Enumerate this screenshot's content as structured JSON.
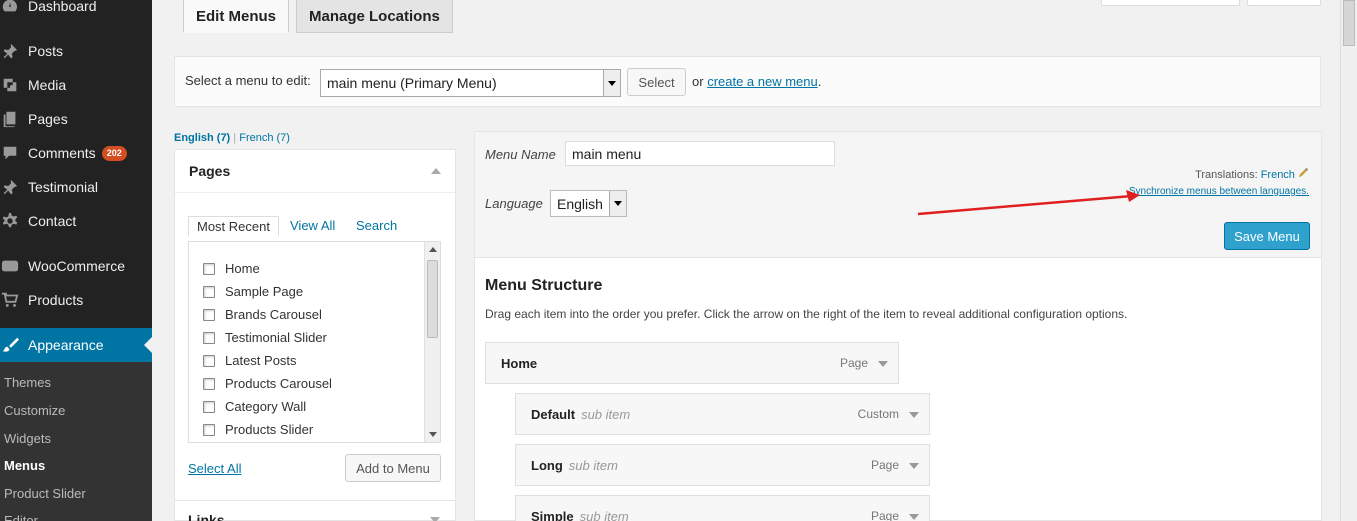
{
  "sidebar": {
    "items": [
      {
        "label": "Dashboard",
        "icon": "dashboard-icon"
      },
      {
        "label": "Posts",
        "icon": "pushpin-icon"
      },
      {
        "label": "Media",
        "icon": "media-icon"
      },
      {
        "label": "Pages",
        "icon": "pages-icon"
      },
      {
        "label": "Comments",
        "icon": "comment-icon",
        "badge": "202"
      },
      {
        "label": "Testimonial",
        "icon": "pushpin-icon"
      },
      {
        "label": "Contact",
        "icon": "gear-icon"
      },
      {
        "label": "WooCommerce",
        "icon": "woocommerce-icon"
      },
      {
        "label": "Products",
        "icon": "cart-icon"
      },
      {
        "label": "Appearance",
        "icon": "paintbrush-icon"
      }
    ],
    "submenu": [
      "Themes",
      "Customize",
      "Widgets",
      "Menus",
      "Product Slider",
      "Editor"
    ]
  },
  "tabs": {
    "edit": "Edit Menus",
    "manage": "Manage Locations"
  },
  "selectbar": {
    "label": "Select a menu to edit:",
    "selected": "main menu (Primary Menu)",
    "button": "Select",
    "or": "or",
    "create_link": "create a new menu",
    "period": "."
  },
  "lang_links": {
    "english": "English (7)",
    "sep": "|",
    "french": "French (7)"
  },
  "pages_box": {
    "title": "Pages",
    "tabs": [
      "Most Recent",
      "View All",
      "Search"
    ],
    "items": [
      "Home",
      "Sample Page",
      "Brands Carousel",
      "Testimonial Slider",
      "Latest Posts",
      "Products Carousel",
      "Category Wall",
      "Products Slider"
    ],
    "select_all": "Select All",
    "add_button": "Add to Menu"
  },
  "links_box": {
    "title": "Links"
  },
  "editor": {
    "menu_name_label": "Menu Name",
    "menu_name_value": "main menu",
    "language_label": "Language",
    "language_value": "English",
    "translations_label": "Translations:",
    "translations_link": "French",
    "sync_link": "Synchronize menus between languages.",
    "save_button": "Save Menu",
    "structure_title": "Menu Structure",
    "structure_help": "Drag each item into the order you prefer. Click the arrow on the right of the item to reveal additional configuration options.",
    "items": [
      {
        "title": "Home",
        "note": "",
        "type": "Page"
      },
      {
        "title": "Default",
        "note": "sub item",
        "type": "Custom"
      },
      {
        "title": "Long",
        "note": "sub item",
        "type": "Page"
      },
      {
        "title": "Simple",
        "note": "sub item",
        "type": "Page"
      }
    ]
  },
  "colors": {
    "accent": "#0074a2",
    "primary_button": "#2ea2cc",
    "badge": "#d54e21",
    "annotation_arrow": "#e02020"
  }
}
